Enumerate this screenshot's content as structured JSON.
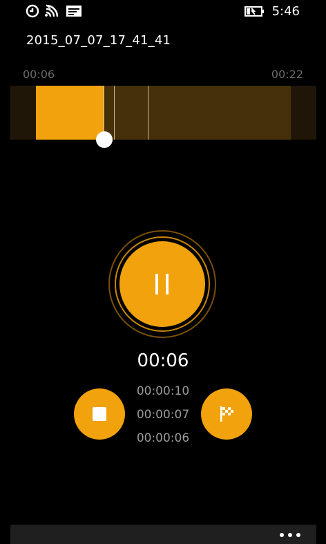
{
  "status_bar": {
    "time": "5:46",
    "icons": [
      "data-sync-icon",
      "wifi-icon",
      "message-icon",
      "battery-charging-icon"
    ]
  },
  "recording": {
    "title": "2015_07_07_17_41_41",
    "timeline_start": "00:06",
    "timeline_end": "00:22",
    "elapsed": "00:06"
  },
  "laps": [
    "00:00:10",
    "00:00:07",
    "00:00:06"
  ],
  "colors": {
    "accent": "#f1a20c",
    "background": "#000000",
    "unplayed": "#46300a",
    "secondary_text": "#9a9a9a"
  },
  "app_bar": {
    "more_icon": "ellipsis-icon"
  }
}
